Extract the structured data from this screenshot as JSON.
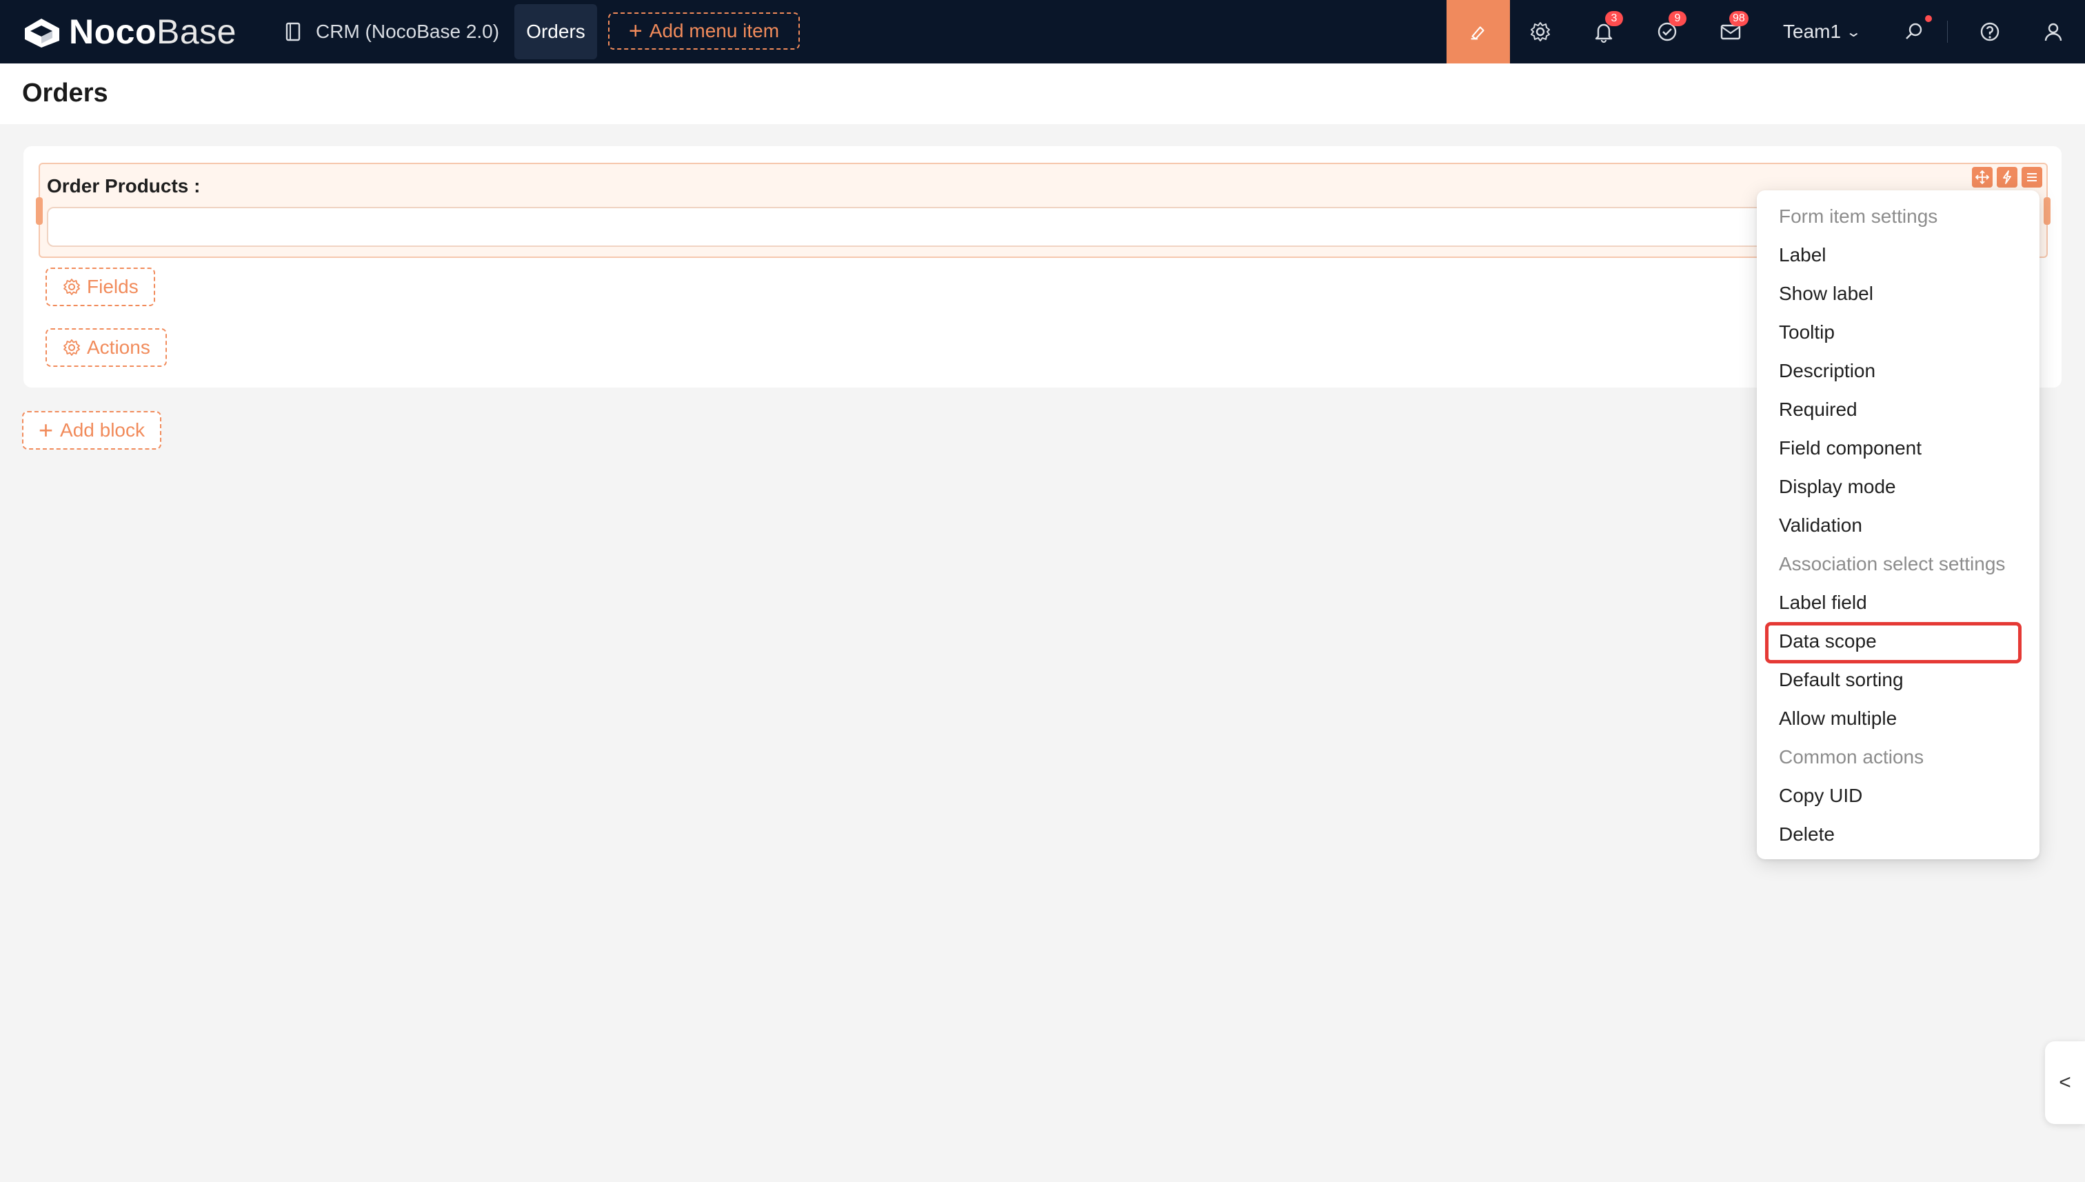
{
  "app": {
    "logo_bold": "Noco",
    "logo_light": "Base",
    "menu": [
      {
        "label": "CRM (NocoBase 2.0)"
      },
      {
        "label": "Orders",
        "active": true
      }
    ],
    "add_menu_item": "Add menu item",
    "team": "Team1",
    "badges": {
      "notifications": "3",
      "tasks": "9",
      "inbox": "98"
    },
    "accent_color": "#f08a5d",
    "header_bg": "#0a1629"
  },
  "page": {
    "title": "Orders"
  },
  "form": {
    "field_label": "Order Products :",
    "fields_button": "Fields",
    "actions_button": "Actions"
  },
  "add_block_button": "Add block",
  "settings_menu": {
    "items": [
      {
        "label": "Form item settings",
        "type": "group"
      },
      {
        "label": "Label"
      },
      {
        "label": "Show label"
      },
      {
        "label": "Tooltip"
      },
      {
        "label": "Description"
      },
      {
        "label": "Required"
      },
      {
        "label": "Field component"
      },
      {
        "label": "Display mode"
      },
      {
        "label": "Validation"
      },
      {
        "label": "Association select settings",
        "type": "group"
      },
      {
        "label": "Label field"
      },
      {
        "label": "Data scope",
        "highlighted": true
      },
      {
        "label": "Default sorting"
      },
      {
        "label": "Allow multiple"
      },
      {
        "label": "Common actions",
        "type": "group"
      },
      {
        "label": "Copy UID"
      },
      {
        "label": "Delete"
      }
    ]
  },
  "side_tab_glyph": "<"
}
